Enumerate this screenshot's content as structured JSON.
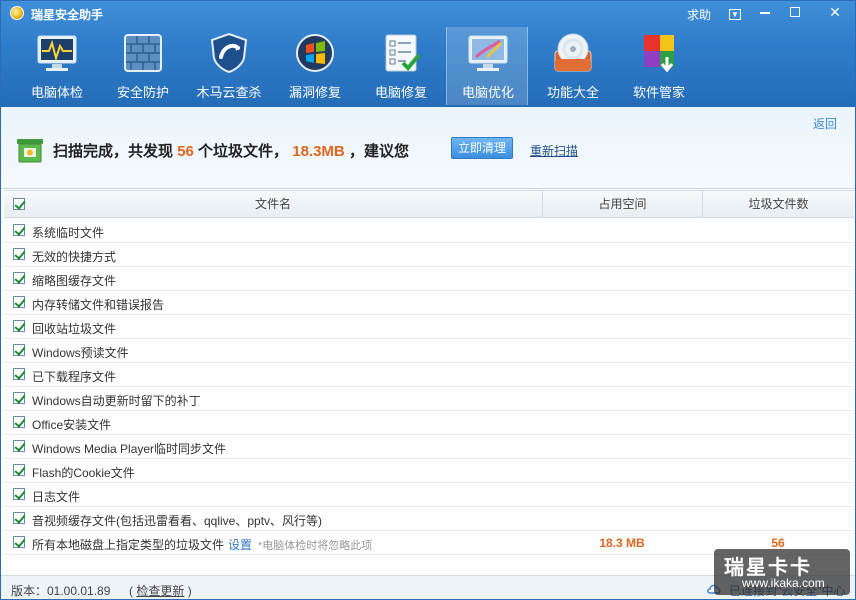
{
  "app": {
    "title": "瑞星安全助手",
    "help": "求助"
  },
  "toolbar": {
    "items": [
      {
        "label": "电脑体检",
        "icon": "monitor-pulse-icon"
      },
      {
        "label": "安全防护",
        "icon": "firewall-icon"
      },
      {
        "label": "木马云查杀",
        "icon": "shield-icon"
      },
      {
        "label": "漏洞修复",
        "icon": "windows-orb-icon"
      },
      {
        "label": "电脑修复",
        "icon": "checklist-icon"
      },
      {
        "label": "电脑优化",
        "icon": "monitor-brush-icon"
      },
      {
        "label": "功能大全",
        "icon": "disc-box-icon"
      },
      {
        "label": "软件管家",
        "icon": "software-blocks-icon"
      }
    ],
    "active_index": 5
  },
  "summary": {
    "back": "返回",
    "prefix": "扫描完成，共发现",
    "count": "56",
    "mid": "个垃圾文件，",
    "size": "18.3MB",
    "suffix": "，建议您",
    "clean_button": "立即清理",
    "rescan": "重新扫描"
  },
  "table": {
    "headers": {
      "name": "文件名",
      "space": "占用空间",
      "count": "垃圾文件数"
    },
    "rows": [
      {
        "name": "系统临时文件"
      },
      {
        "name": "无效的快捷方式"
      },
      {
        "name": "缩略图缓存文件"
      },
      {
        "name": "内存转储文件和错误报告"
      },
      {
        "name": "回收站垃圾文件"
      },
      {
        "name": "Windows预读文件"
      },
      {
        "name": "已下载程序文件"
      },
      {
        "name": "Windows自动更新时留下的补丁"
      },
      {
        "name": "Office安装文件"
      },
      {
        "name": "Windows Media Player临时同步文件"
      },
      {
        "name": "Flash的Cookie文件"
      },
      {
        "name": "日志文件"
      },
      {
        "name": "音视频缓存文件(包括迅雷看看、qqlive、pptv、风行等)"
      }
    ],
    "total_row": {
      "name": "所有本地磁盘上指定类型的垃圾文件",
      "setting": "设置",
      "hint": "*电脑体检时将忽略此项",
      "size": "18.3 MB",
      "count": "56"
    }
  },
  "status": {
    "version": "版本：01.00.01.89",
    "check_update": "检查更新",
    "cloud": "已连接到\"云安全\"中心"
  },
  "watermark": {
    "line1": "瑞星卡卡",
    "line2": "www.ikaka.com"
  },
  "colors": {
    "accent_blue": "#2e7cc9",
    "highlight_orange": "#e0651f",
    "link_blue": "#2f7ac4"
  }
}
